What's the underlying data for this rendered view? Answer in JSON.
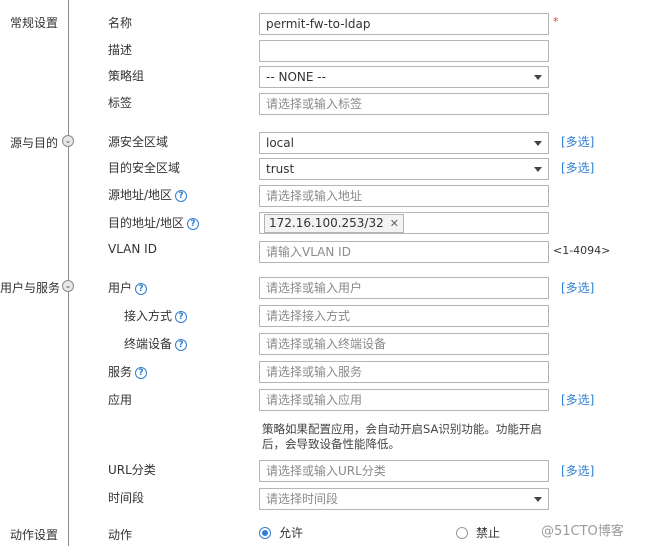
{
  "sections": {
    "general": "常规设置",
    "source_dest": "源与目的",
    "user_service": "用户与服务",
    "action": "动作设置"
  },
  "fields": {
    "name": {
      "label": "名称",
      "value": "permit-fw-to-ldap",
      "required": "*"
    },
    "description": {
      "label": "描述",
      "value": ""
    },
    "policy_group": {
      "label": "策略组",
      "value": "-- NONE --"
    },
    "tag": {
      "label": "标签",
      "placeholder": "请选择或输入标签"
    },
    "src_zone": {
      "label": "源安全区域",
      "value": "local",
      "link": "[多选]"
    },
    "dst_zone": {
      "label": "目的安全区域",
      "value": "trust",
      "link": "[多选]"
    },
    "src_addr": {
      "label": "源地址/地区",
      "placeholder": "请选择或输入地址"
    },
    "dst_addr": {
      "label": "目的地址/地区",
      "chip": "172.16.100.253/32",
      "chip_close": "✕"
    },
    "vlan": {
      "label": "VLAN ID",
      "placeholder": "请输入VLAN ID",
      "hint": "<1-4094>"
    },
    "user": {
      "label": "用户",
      "placeholder": "请选择或输入用户",
      "link": "[多选]"
    },
    "access": {
      "label": "接入方式",
      "placeholder": "请选择接入方式"
    },
    "terminal": {
      "label": "终端设备",
      "placeholder": "请选择或输入终端设备"
    },
    "service": {
      "label": "服务",
      "placeholder": "请选择或输入服务"
    },
    "application": {
      "label": "应用",
      "placeholder": "请选择或输入应用",
      "link": "[多选]"
    },
    "app_note": "策略如果配置应用，会自动开启SA识别功能。功能开启后，会导致设备性能降低。",
    "url_category": {
      "label": "URL分类",
      "placeholder": "请选择或输入URL分类",
      "link": "[多选]"
    },
    "time_range": {
      "label": "时间段",
      "placeholder": "请选择时间段"
    },
    "action": {
      "label": "动作",
      "permit": "允许",
      "deny": "禁止"
    }
  },
  "help_icon": "?",
  "toggle_icon": "⌄",
  "watermark": "@51CTO博客",
  "colors": {
    "link": "#2f7fd1",
    "required": "#e53935",
    "placeholder": "#8a8a8a"
  }
}
